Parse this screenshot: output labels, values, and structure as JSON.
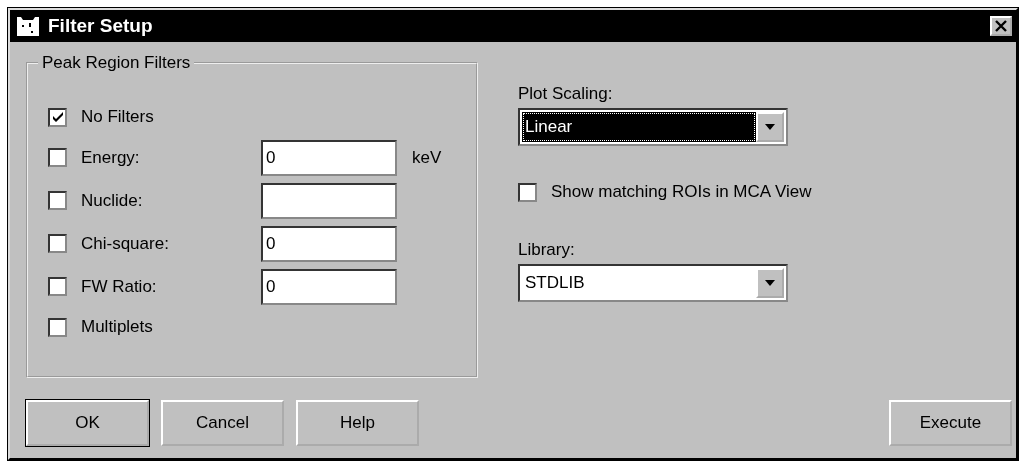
{
  "window": {
    "title": "Filter Setup"
  },
  "peak_region_filters": {
    "title": "Peak Region Filters",
    "items": [
      {
        "label": "No Filters",
        "checked": true
      },
      {
        "label": "Energy:",
        "checked": false,
        "value": "0",
        "unit": "keV"
      },
      {
        "label": "Nuclide:",
        "checked": false,
        "value": ""
      },
      {
        "label": "Chi-square:",
        "checked": false,
        "value": "0"
      },
      {
        "label": "FW Ratio:",
        "checked": false,
        "value": "0"
      },
      {
        "label": "Multiplets",
        "checked": false
      }
    ]
  },
  "plot_scaling": {
    "label": "Plot Scaling:",
    "value": "Linear",
    "focused": true
  },
  "show_matching_rois": {
    "label": "Show matching ROIs in MCA View",
    "checked": false
  },
  "library": {
    "label": "Library:",
    "value": "STDLIB",
    "focused": false
  },
  "buttons": [
    {
      "label": "OK",
      "default": true
    },
    {
      "label": "Cancel",
      "default": false
    },
    {
      "label": "Help",
      "default": false
    }
  ],
  "execute_button": {
    "label": "Execute"
  }
}
